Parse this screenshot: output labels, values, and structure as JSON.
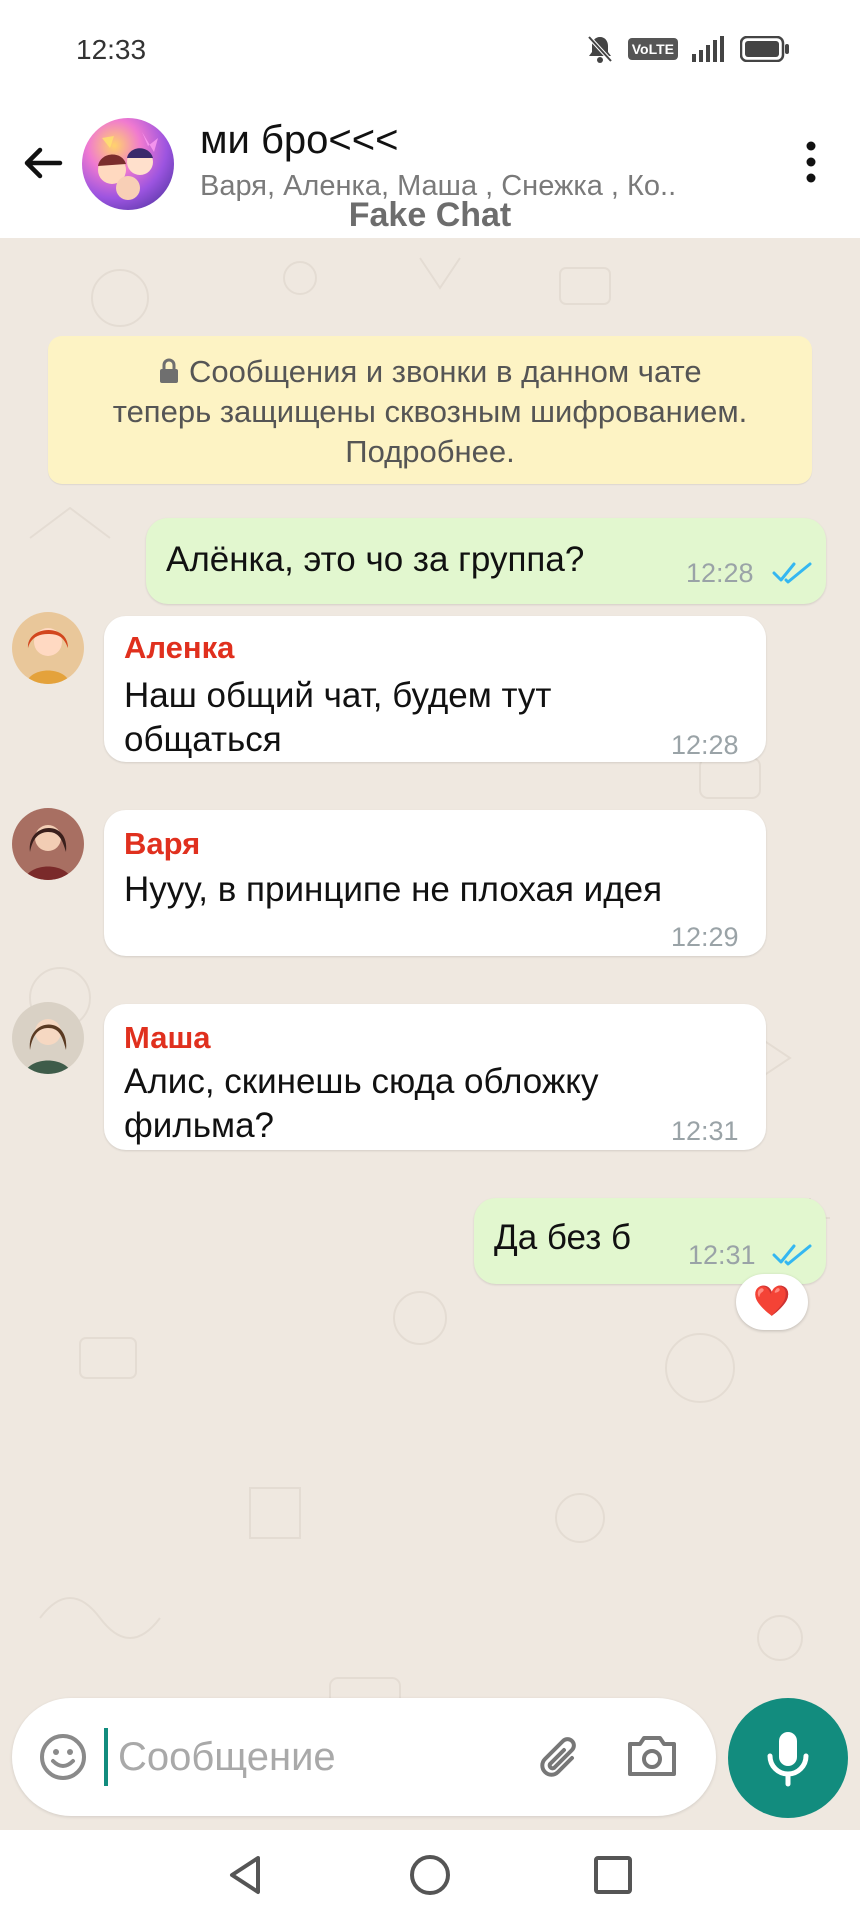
{
  "status_bar": {
    "time": "12:33",
    "network_label": "VoLTE"
  },
  "header": {
    "title": "ми бро<<<",
    "members": "Варя, Аленка, Маша , Снежка , Ко..",
    "watermark": "Fake Chat"
  },
  "encryption_notice": {
    "line1": "Сообщения и звонки в данном чате",
    "line2": "теперь защищены сквозным шифрованием.",
    "line3": "Подробнее."
  },
  "messages": [
    {
      "direction": "outgoing",
      "text": "Алёнка, это чо за группа?",
      "time": "12:28",
      "status": "read"
    },
    {
      "direction": "incoming",
      "sender": "Аленка",
      "text_line1": "Наш общий чат, будем тут",
      "text_line2": "общаться",
      "time": "12:28"
    },
    {
      "direction": "incoming",
      "sender": "Варя",
      "text_line1": "Нууу, в принципе не плохая идея",
      "time": "12:29"
    },
    {
      "direction": "incoming",
      "sender": "Маша",
      "text_line1": "Алис, скинешь сюда обложку",
      "text_line2": "фильма?",
      "time": "12:31"
    },
    {
      "direction": "outgoing",
      "text": "Да без б",
      "time": "12:31",
      "status": "read",
      "reaction": "❤️"
    }
  ],
  "composer": {
    "placeholder": "Сообщение"
  },
  "colors": {
    "accent": "#128c7e",
    "outgoing_bubble": "#e2f7cf",
    "sender_name": "#e0301e",
    "read_ticks": "#34b7f1",
    "chat_background": "#efe8e0",
    "notice_background": "#fdf3c4"
  }
}
